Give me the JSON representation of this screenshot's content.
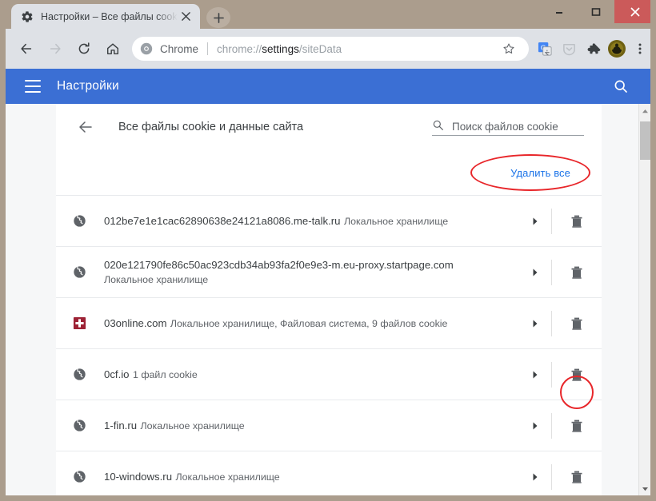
{
  "window": {
    "tab": {
      "title": "Настройки – Все файлы cookie и",
      "favicon": "gear-icon",
      "close_label": "✕",
      "newtab_label": "+"
    },
    "controls": {
      "minimize": "–",
      "maximize": "▢",
      "close": "✕"
    }
  },
  "toolbar": {
    "back": "back-arrow-icon",
    "forward": "forward-arrow-icon",
    "reload": "reload-icon",
    "home": "home-icon",
    "omnibox": {
      "site_label": "Chrome",
      "url_scheme": "chrome://",
      "url_bold": "settings",
      "url_tail": "/siteData",
      "bookmark": "star-icon"
    },
    "extensions": [
      "google-translate-icon",
      "pocket-icon",
      "puzzle-extensions-icon"
    ],
    "profile_avatar": "avatar",
    "menu": "three-dot-menu-icon"
  },
  "settings_header": {
    "menu_icon": "hamburger-icon",
    "title": "Настройки",
    "search_icon": "search-icon"
  },
  "page": {
    "back_icon": "back-arrow-icon",
    "title": "Все файлы cookie и данные сайта",
    "search": {
      "icon": "search-icon",
      "placeholder": "Поиск файлов cookie",
      "value": ""
    },
    "remove_all_label": "Удалить все",
    "annotations": {
      "color": "#e8262a",
      "targets": [
        "remove-all-button",
        "trash-button-row-0cf.io"
      ]
    },
    "rows": [
      {
        "favicon": "globe-icon",
        "site": "012be7e1e1cac62890638e24121a8086.me-talk.ru",
        "detail": "Локальное хранилище",
        "expand": "▸",
        "delete": "trash-icon",
        "highlighted": false
      },
      {
        "favicon": "globe-icon",
        "site": "020e121790fe86c50ac923cdb34ab93fa2f0e9e3-m.eu-proxy.startpage.com",
        "detail": "Локальное хранилище",
        "expand": "▸",
        "delete": "trash-icon",
        "highlighted": false
      },
      {
        "favicon": "swiss-cross-icon",
        "site": "03online.com",
        "detail": "Локальное хранилище, Файловая система, 9 файлов cookie",
        "expand": "▸",
        "delete": "trash-icon",
        "highlighted": false
      },
      {
        "favicon": "globe-icon",
        "site": "0cf.io",
        "detail": "1 файл cookie",
        "expand": "▸",
        "delete": "trash-icon",
        "highlighted": true
      },
      {
        "favicon": "globe-icon",
        "site": "1-fin.ru",
        "detail": "Локальное хранилище",
        "expand": "▸",
        "delete": "trash-icon",
        "highlighted": false
      },
      {
        "favicon": "globe-icon",
        "site": "10-windows.ru",
        "detail": "Локальное хранилище",
        "expand": "▸",
        "delete": "trash-icon",
        "highlighted": false
      }
    ]
  },
  "scrollbar": {
    "up": "▲",
    "down": "▼"
  },
  "colors": {
    "frame": "#ab9d8d",
    "toolbar": "#dee1e6",
    "settings_header": "#3b6fd4",
    "accent_link": "#1a73e8",
    "annotation": "#e8262a",
    "page_bg": "#f6f7f8",
    "close_button": "#cb5a5a"
  }
}
